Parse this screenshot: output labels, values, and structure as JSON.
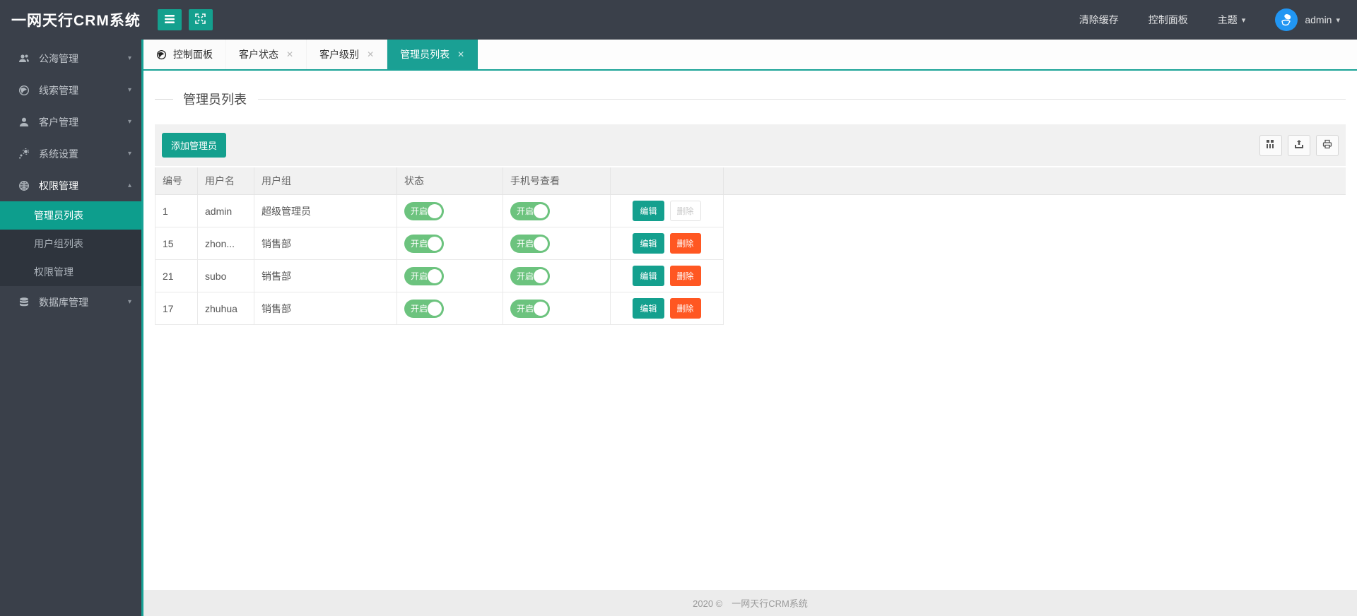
{
  "app": {
    "title": "一网天行CRM系统",
    "footer_text": "2020 ©　一网天行CRM系统"
  },
  "navbar": {
    "clear_cache": "清除缓存",
    "control_panel": "控制面板",
    "theme": "主题",
    "username": "admin"
  },
  "icons": {
    "caret_down": "▾",
    "caret_up": "▴",
    "close": "✕"
  },
  "colors": {
    "dark_bg": "#3A404A",
    "submenu_bg": "#2E343D",
    "accent_teal": "#14A08E",
    "tab_active": "#1AA094",
    "toggle_green": "#6CC37E",
    "delete_orange": "#FF5722",
    "avatar_blue": "#2196F3",
    "toolbar_gray": "#F1F1F1",
    "footer_gray": "#ECECEC"
  },
  "sidebar": {
    "items": [
      {
        "label": "公海管理",
        "icon": "users-icon"
      },
      {
        "label": "线索管理",
        "icon": "globe-icon"
      },
      {
        "label": "客户管理",
        "icon": "user-icon"
      },
      {
        "label": "系统设置",
        "icon": "gear-icon"
      },
      {
        "label": "权限管理",
        "icon": "globe-grid-icon",
        "expanded": true
      },
      {
        "label": "数据库管理",
        "icon": "database-icon"
      }
    ],
    "permission_children": [
      {
        "label": "管理员列表",
        "active": true
      },
      {
        "label": "用户组列表",
        "active": false
      },
      {
        "label": "权限管理",
        "active": false
      }
    ]
  },
  "tabs": [
    {
      "label": "控制面板",
      "closable": false,
      "active": false
    },
    {
      "label": "客户状态",
      "closable": true,
      "active": false
    },
    {
      "label": "客户级别",
      "closable": true,
      "active": false
    },
    {
      "label": "管理员列表",
      "closable": true,
      "active": true
    }
  ],
  "page": {
    "title": "管理员列表",
    "add_button": "添加管理员"
  },
  "table": {
    "headers": [
      "编号",
      "用户名",
      "用户组",
      "状态",
      "手机号查看",
      ""
    ],
    "toggle_on_label": "开启",
    "edit_label": "编辑",
    "delete_label": "删除",
    "rows": [
      {
        "id": "1",
        "username": "admin",
        "group": "超级管理员",
        "status": "开启",
        "phone_view": "开启",
        "delete_disabled": true
      },
      {
        "id": "15",
        "username": "zhon...",
        "group": "销售部",
        "status": "开启",
        "phone_view": "开启",
        "delete_disabled": false
      },
      {
        "id": "21",
        "username": "subo",
        "group": "销售部",
        "status": "开启",
        "phone_view": "开启",
        "delete_disabled": false
      },
      {
        "id": "17",
        "username": "zhuhua",
        "group": "销售部",
        "status": "开启",
        "phone_view": "开启",
        "delete_disabled": false
      }
    ]
  }
}
